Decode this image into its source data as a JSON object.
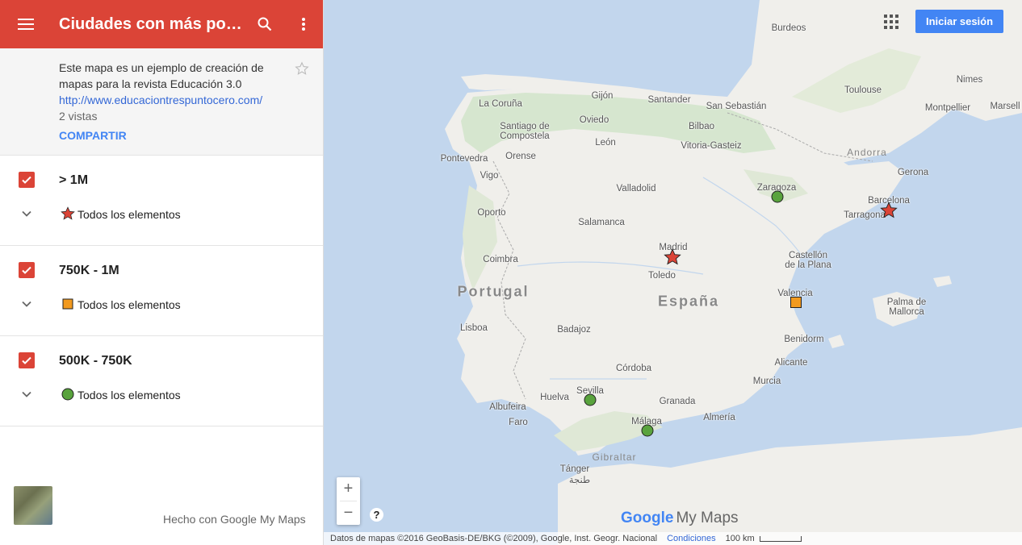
{
  "header": {
    "title": "Ciudades con más pobl...",
    "menu_icon": "menu-icon",
    "search_icon": "search-icon",
    "more_icon": "more-vert-icon"
  },
  "info": {
    "description": "Este mapa es un ejemplo de creación de mapas para la revista Educación 3.0",
    "link": "http://www.educaciontrespuntocero.com/",
    "views": "2 vistas",
    "share": "COMPARTIR"
  },
  "layers": [
    {
      "name": "> 1M",
      "all_label": "Todos los elementos",
      "symbol": "star",
      "color": "#db4437"
    },
    {
      "name": "750K - 1M",
      "all_label": "Todos los elementos",
      "symbol": "square",
      "color": "#f29a1f"
    },
    {
      "name": "500K - 750K",
      "all_label": "Todos los elementos",
      "symbol": "circle",
      "color": "#59a33d"
    }
  ],
  "footer_left": {
    "made_with": "Hecho con Google My Maps"
  },
  "map": {
    "signin": "Iniciar sesión",
    "brand_google": "Google",
    "brand_mymaps": "My Maps",
    "attribution": "Datos de mapas ©2016 GeoBasis-DE/BKG (©2009), Google, Inst. Geogr. Nacional",
    "terms": "Condiciones",
    "scale": "100 km",
    "countries": {
      "portugal": "Portugal",
      "espana": "España"
    },
    "regions": {
      "andorra": "Andorra",
      "gibraltar": "Gibraltar"
    },
    "cities": {
      "burdeos": "Burdeos",
      "toulouse": "Toulouse",
      "nimes": "Nimes",
      "montpellier": "Montpellier",
      "marseille": "Marsell",
      "corunna": "La Coruña",
      "gijon": "Gijón",
      "oviedo": "Oviedo",
      "santander": "Santander",
      "sansebastian": "San Sebastián",
      "bilbao": "Bilbao",
      "vitoria": "Vitoria-Gasteiz",
      "santiago": "Santiago de\nCompostela",
      "leon": "León",
      "orense": "Orense",
      "pontevedra": "Pontevedra",
      "vigo": "Vigo",
      "girona": "Gerona",
      "valladolid": "Valladolid",
      "zaragoza": "Zaragoza",
      "barcelona": "Barcelona",
      "tarragona": "Tarragona",
      "oporto": "Oporto",
      "salamanca": "Salamanca",
      "madrid": "Madrid",
      "coimbra": "Coimbra",
      "toledo": "Toledo",
      "castellon": "Castellón\nde la Plana",
      "valencia": "Valencia",
      "palma": "Palma de\nMallorca",
      "lisboa": "Lisboa",
      "badajoz": "Badajoz",
      "benidorm": "Benidorm",
      "alicante": "Alicante",
      "cordoba": "Córdoba",
      "sevilla": "Sevilla",
      "huelva": "Huelva",
      "murcia": "Murcia",
      "albufeira": "Albufeira",
      "faro": "Faro",
      "granada": "Granada",
      "almeria": "Almería",
      "malaga": "Málaga",
      "tanger": "Tánger",
      "tanger_ar": "طنجة"
    }
  }
}
